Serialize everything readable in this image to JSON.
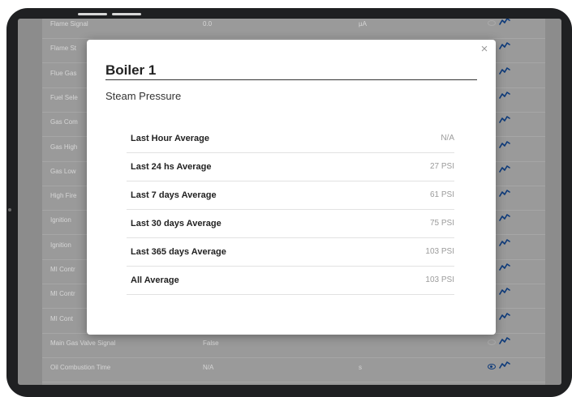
{
  "background_table": {
    "rows": [
      {
        "name": "Flame Signal",
        "value": "0.0",
        "unit": "µA",
        "visible": false
      },
      {
        "name": "Flame St",
        "value": "",
        "unit": "",
        "visible": false
      },
      {
        "name": "Flue Gas",
        "value": "",
        "unit": "",
        "visible": true
      },
      {
        "name": "Fuel Sele",
        "value": "",
        "unit": "",
        "visible": true
      },
      {
        "name": "Gas Com",
        "value": "",
        "unit": "",
        "visible": true
      },
      {
        "name": "Gas High",
        "value": "",
        "unit": "",
        "visible": true
      },
      {
        "name": "Gas Low",
        "value": "",
        "unit": "",
        "visible": true
      },
      {
        "name": "High Fire",
        "value": "",
        "unit": "",
        "visible": false
      },
      {
        "name": "Ignition",
        "value": "",
        "unit": "",
        "visible": true
      },
      {
        "name": "Ignition",
        "value": "",
        "unit": "",
        "visible": false
      },
      {
        "name": "MI Contr",
        "value": "",
        "unit": "",
        "visible": false
      },
      {
        "name": "MI Contr",
        "value": "",
        "unit": "",
        "visible": false
      },
      {
        "name": "MI Cont",
        "value": "",
        "unit": "",
        "visible": false
      },
      {
        "name": "Main Gas Valve Signal",
        "value": "False",
        "unit": "",
        "visible": false
      },
      {
        "name": "Oil Combustion Time",
        "value": "N/A",
        "unit": "s",
        "visible": true
      }
    ]
  },
  "modal": {
    "close": "×",
    "title": "Boiler 1",
    "subtitle": "Steam Pressure",
    "stats": [
      {
        "label": "Last Hour Average",
        "value": "N/A"
      },
      {
        "label": "Last 24 hs Average",
        "value": "27 PSI"
      },
      {
        "label": "Last 7 days Average",
        "value": "61 PSI"
      },
      {
        "label": "Last 30 days Average",
        "value": "75 PSI"
      },
      {
        "label": "Last 365 days Average",
        "value": "103 PSI"
      },
      {
        "label": "All Average",
        "value": "103 PSI"
      }
    ]
  },
  "colors": {
    "accent": "#0d3a7a",
    "overlay": "#8c8c8c"
  }
}
